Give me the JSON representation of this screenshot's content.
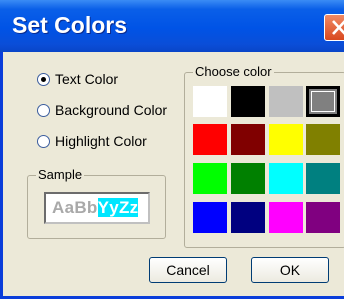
{
  "window": {
    "title": "Set Colors"
  },
  "radios": [
    {
      "label": "Text Color",
      "checked": true
    },
    {
      "label": "Background Color",
      "checked": false
    },
    {
      "label": "Highlight Color",
      "checked": false
    }
  ],
  "sample": {
    "legend": "Sample",
    "text_normal": "AaBb",
    "text_highlighted": "YyZz",
    "text_color": "#A9A9A9",
    "highlight_color": "#00E6FF"
  },
  "palette": {
    "legend": "Choose color",
    "swatches": [
      {
        "name": "white",
        "color": "#FFFFFF",
        "selected": false
      },
      {
        "name": "black",
        "color": "#000000",
        "selected": false
      },
      {
        "name": "silver",
        "color": "#C0C0C0",
        "selected": false
      },
      {
        "name": "gray",
        "color": "#808080",
        "selected": true
      },
      {
        "name": "red",
        "color": "#FF0000",
        "selected": false
      },
      {
        "name": "maroon",
        "color": "#800000",
        "selected": false
      },
      {
        "name": "yellow",
        "color": "#FFFF00",
        "selected": false
      },
      {
        "name": "olive",
        "color": "#808000",
        "selected": false
      },
      {
        "name": "lime",
        "color": "#00FF00",
        "selected": false
      },
      {
        "name": "green",
        "color": "#008000",
        "selected": false
      },
      {
        "name": "cyan",
        "color": "#00FFFF",
        "selected": false
      },
      {
        "name": "teal",
        "color": "#008080",
        "selected": false
      },
      {
        "name": "blue",
        "color": "#0000FF",
        "selected": false
      },
      {
        "name": "navy",
        "color": "#000080",
        "selected": false
      },
      {
        "name": "magenta",
        "color": "#FF00FF",
        "selected": false
      },
      {
        "name": "purple",
        "color": "#800080",
        "selected": false
      }
    ]
  },
  "buttons": {
    "cancel": "Cancel",
    "ok": "OK"
  },
  "icons": {
    "close": "close-icon"
  }
}
